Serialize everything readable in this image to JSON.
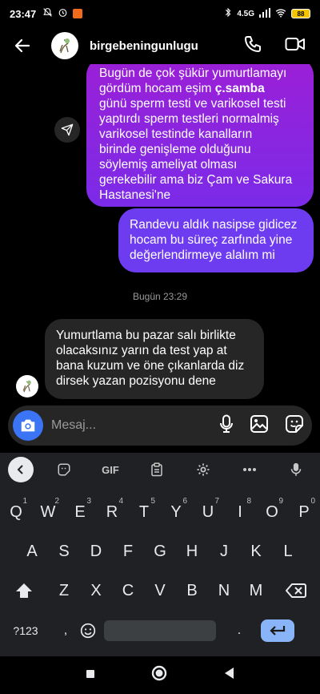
{
  "status_bar": {
    "time": "23:47",
    "network": "4.5G",
    "battery": "88"
  },
  "header": {
    "username": "birgebeningunlugu"
  },
  "messages": {
    "outgoing_1": {
      "lines": [
        "Bugün de çok şükür yumurtlamayı",
        "gördüm hocam eşim ",
        "günü sperm testi ve varikosel testi",
        "yaptırdı sperm testleri normalmiş",
        "varikosel testinde kanalların",
        "birinde genişleme olduğunu",
        "söylemiş ameliyat olması",
        "gerekebilir ama biz Çam ve Sakura",
        "Hastanesi'ne"
      ],
      "bold_mention": "ç.samba"
    },
    "outgoing_2": {
      "lines": [
        "Randevu aldık nasipse gidicez",
        "hocam bu süreç zarfında yine",
        "değerlendirmeye alalım mi"
      ]
    },
    "timestamp": "Bugün 23:29",
    "incoming_1": {
      "lines": [
        "Yumurtlama bu pazar salı birlikte",
        "olacaksınız yarın da test yap at",
        "bana kuzum ve öne çıkanlarda diz",
        "dirsek yazan pozisyonu dene"
      ]
    }
  },
  "composer": {
    "placeholder": "Mesaj..."
  },
  "keyboard": {
    "toolbar": {
      "gif_label": "GIF"
    },
    "row1": [
      {
        "k": "Q",
        "h": "1"
      },
      {
        "k": "W",
        "h": "2"
      },
      {
        "k": "E",
        "h": "3"
      },
      {
        "k": "R",
        "h": "4"
      },
      {
        "k": "T",
        "h": "5"
      },
      {
        "k": "Y",
        "h": "6"
      },
      {
        "k": "U",
        "h": "7"
      },
      {
        "k": "I",
        "h": "8"
      },
      {
        "k": "O",
        "h": "9"
      },
      {
        "k": "P",
        "h": "0"
      }
    ],
    "row2": [
      "A",
      "S",
      "D",
      "F",
      "G",
      "H",
      "J",
      "K",
      "L"
    ],
    "row3": [
      "Z",
      "X",
      "C",
      "V",
      "B",
      "N",
      "M"
    ],
    "symbols_label": "?123",
    "comma": ",",
    "period": "."
  },
  "colors": {
    "outgoing_top": "#9b1fd6",
    "outgoing_bottom": "#6e3cf0",
    "incoming": "#262626",
    "camera_button": "#3b74f5",
    "enter_key": "#8ab4f8"
  }
}
